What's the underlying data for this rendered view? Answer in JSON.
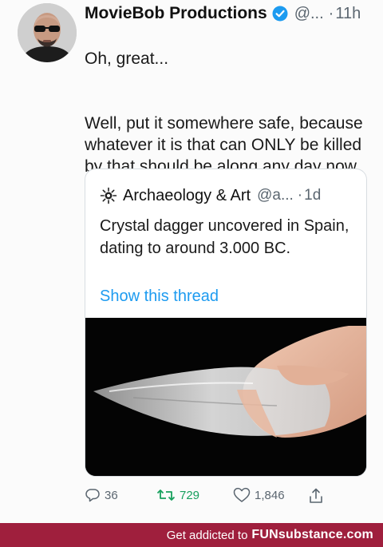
{
  "tweet": {
    "display_name": "MovieBob Productions",
    "handle": "@...",
    "separator": "·",
    "time": "11h",
    "text_line1": "Oh, great...",
    "text_body": "Well, put it somewhere safe, because whatever it is that can ONLY be killed by that should be along any day now."
  },
  "quoted": {
    "display_name": "Archaeology & Art",
    "handle": "@a...",
    "separator": "·",
    "time": "1d",
    "text": "Crystal dagger uncovered in Spain, dating to around 3.000 BC.",
    "show_thread_label": "Show this thread"
  },
  "actions": {
    "replies": "36",
    "retweets": "729",
    "likes": "1,846"
  },
  "banner": {
    "prefix": "Get addicted to",
    "brand": "FUNsubstance.com"
  },
  "colors": {
    "link": "#1d9bf0",
    "retweet": "#17a05d",
    "verified": "#1d9bf0",
    "banner": "#9f1f3d"
  },
  "icons": [
    "verified-badge-icon",
    "sunburst-logo-icon",
    "reply-icon",
    "retweet-icon",
    "like-icon",
    "share-icon"
  ]
}
